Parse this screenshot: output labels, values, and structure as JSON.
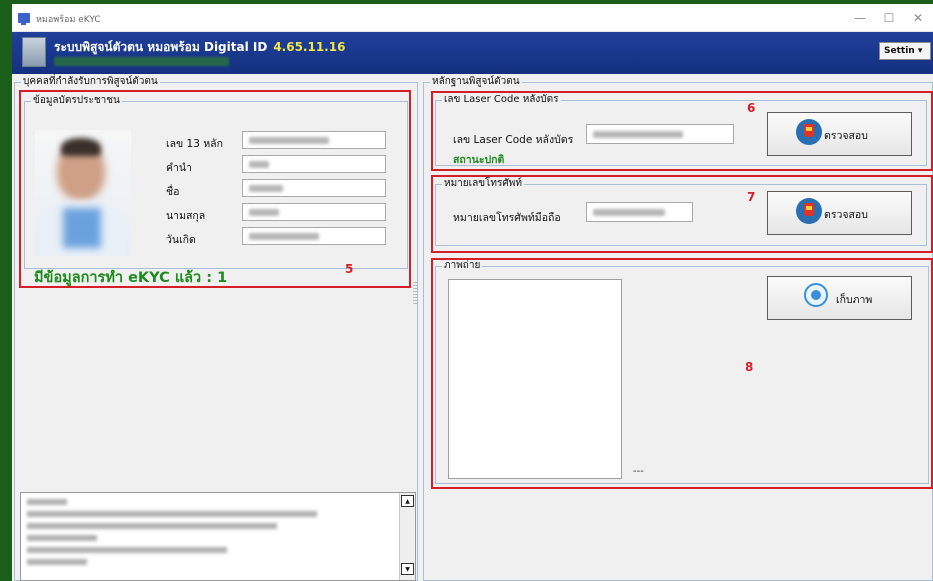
{
  "window": {
    "title": "หมอพร้อม eKYC",
    "controls": {
      "minimize": "—",
      "maximize": "☐",
      "close": "✕"
    }
  },
  "header": {
    "title": "ระบบพิสูจน์ตัวตน หมอพร้อม Digital ID",
    "version": "4.65.11.16",
    "settings_label": "Settin ▾"
  },
  "left_panel": {
    "group_label": "บุคคลที่กำลังรับการพิสูจน์ตัวตน",
    "card_group_label": "ข้อมูลบัตรประชาชน",
    "fields": [
      {
        "label": "เลข 13 หลัก"
      },
      {
        "label": "คำนำ"
      },
      {
        "label": "ชื่อ"
      },
      {
        "label": "นามสกุล"
      },
      {
        "label": "วันเกิด"
      }
    ],
    "ekyc_status": "มีข้อมูลการทำ eKYC แล้ว : 1",
    "annotation": "5",
    "scroll_up": "▲",
    "scroll_down": "▼"
  },
  "right_panel": {
    "group_label": "หลักฐานพิสูจน์ตัวตน",
    "laser": {
      "group_label": "เลข Laser Code หลังบัตร",
      "field_label": "เลข Laser Code หลังบัตร",
      "status": "สถานะปกติ",
      "button_label": "ตรวจสอบ",
      "annotation": "6"
    },
    "phone": {
      "group_label": "หมายเลขโทรศัพท์",
      "field_label": "หมายเลขโทรศัพท์มือถือ",
      "button_label": "ตรวจสอบ",
      "annotation": "7"
    },
    "photo": {
      "group_label": "ภาพถ่าย",
      "caption": "---",
      "button_label": "เก็บภาพ",
      "annotation": "8"
    }
  },
  "colors": {
    "accent_red": "#d41f2a",
    "status_green": "#1f8a1f",
    "header_blue": "#1f3f9a",
    "version_yellow": "#f1e54a"
  }
}
